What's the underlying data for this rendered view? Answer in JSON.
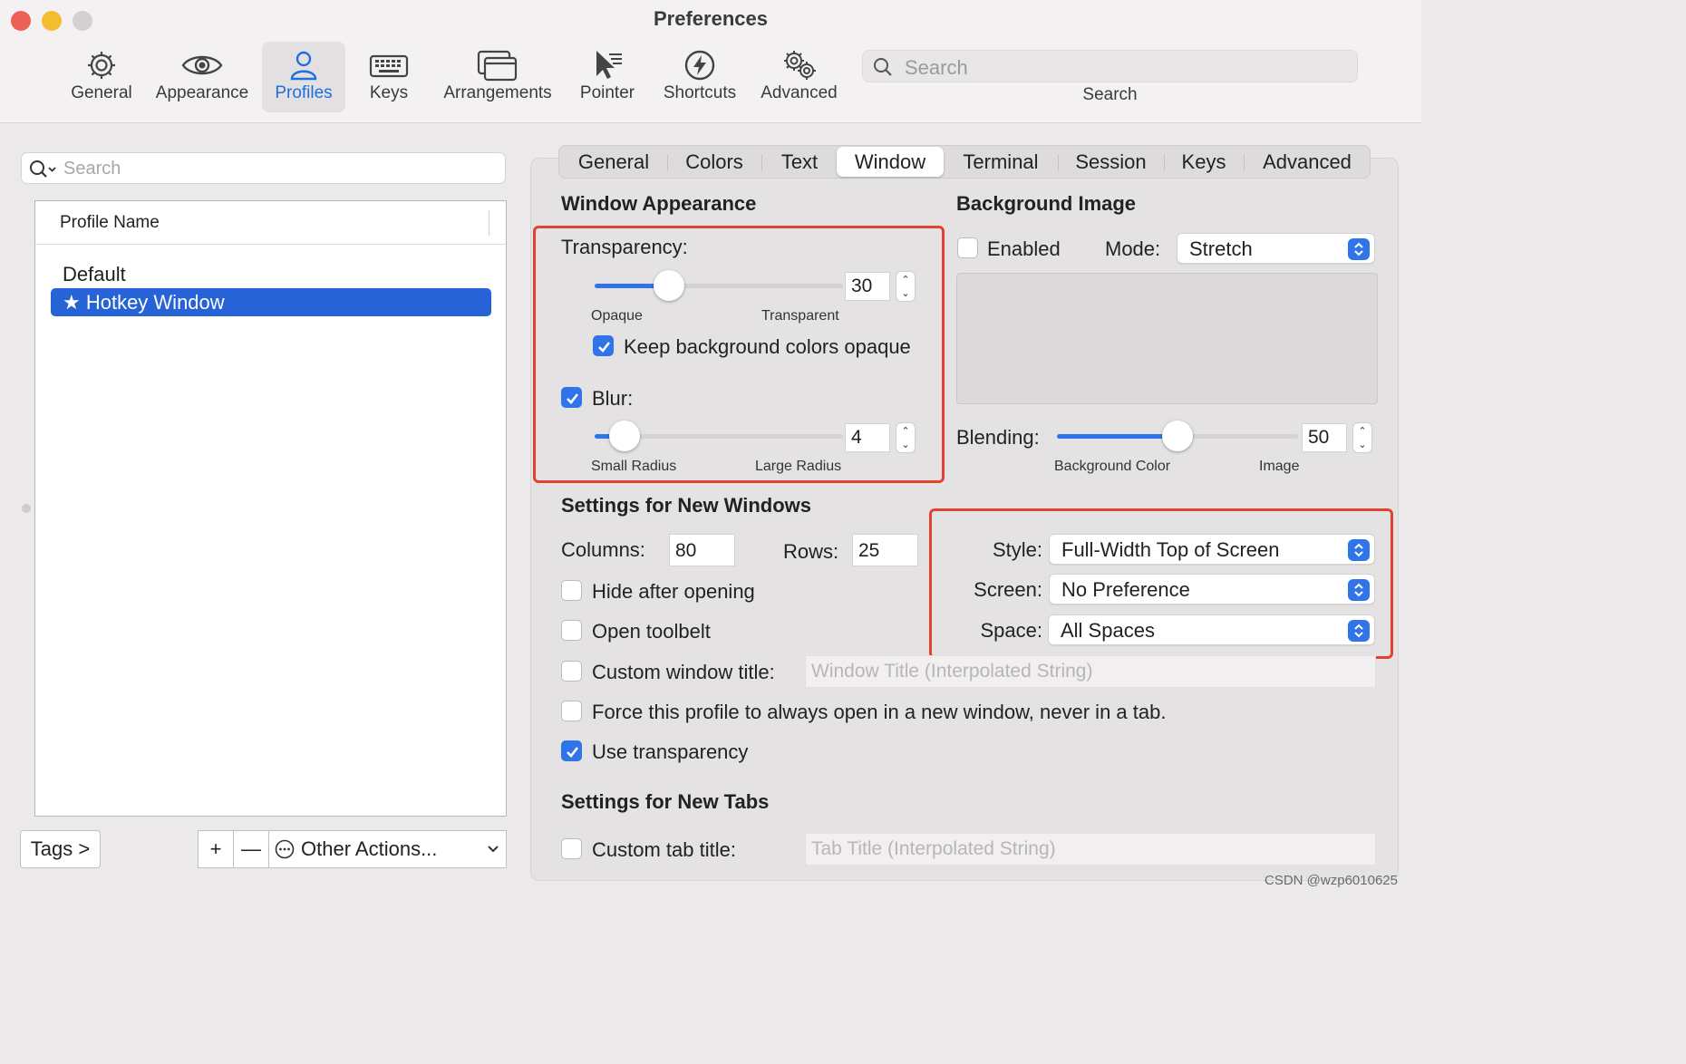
{
  "window": {
    "title": "Preferences",
    "traffic_lights": {
      "close": "#ee5f57",
      "minimize": "#f4bd2f",
      "zoom": "#d3d0d1"
    }
  },
  "toolbar": {
    "items": [
      {
        "label": "General",
        "icon": "gear-icon"
      },
      {
        "label": "Appearance",
        "icon": "eye-icon"
      },
      {
        "label": "Profiles",
        "icon": "person-icon",
        "active": true
      },
      {
        "label": "Keys",
        "icon": "keyboard-icon"
      },
      {
        "label": "Arrangements",
        "icon": "windows-icon"
      },
      {
        "label": "Pointer",
        "icon": "cursor-icon"
      },
      {
        "label": "Shortcuts",
        "icon": "lightning-icon"
      },
      {
        "label": "Advanced",
        "icon": "gears-icon"
      }
    ],
    "search_placeholder": "Search",
    "search_label": "Search",
    "accent": "#1f6fe0"
  },
  "profiles": {
    "search_placeholder": "Search",
    "column_header": "Profile Name",
    "items": [
      {
        "name": "Default"
      },
      {
        "name": "★ Hotkey Window",
        "selected": true
      }
    ],
    "tags_button": "Tags >",
    "add_button": "+",
    "remove_button": "—",
    "other_actions": "Other Actions..."
  },
  "tabs": [
    "General",
    "Colors",
    "Text",
    "Window",
    "Terminal",
    "Session",
    "Keys",
    "Advanced"
  ],
  "active_tab": "Window",
  "window_appearance": {
    "heading": "Window Appearance",
    "transparency_label": "Transparency:",
    "transparency_value": "30",
    "transparency_fraction": 0.3,
    "transparency_min": "Opaque",
    "transparency_max": "Transparent",
    "keep_bg_label": "Keep background colors opaque",
    "keep_bg_checked": true,
    "blur_label": "Blur:",
    "blur_checked": true,
    "blur_value": "4",
    "blur_fraction": 0.12,
    "blur_min": "Small Radius",
    "blur_max": "Large Radius"
  },
  "background_image": {
    "heading": "Background Image",
    "enabled_label": "Enabled",
    "enabled_checked": false,
    "mode_label": "Mode:",
    "mode_value": "Stretch",
    "blending_label": "Blending:",
    "blending_value": "50",
    "blending_fraction": 0.5,
    "blending_min": "Background Color",
    "blending_max": "Image"
  },
  "new_windows": {
    "heading": "Settings for New Windows",
    "columns_label": "Columns:",
    "columns_value": "80",
    "rows_label": "Rows:",
    "rows_value": "25",
    "style_label": "Style:",
    "style_value": "Full-Width Top of Screen",
    "screen_label": "Screen:",
    "screen_value": "No Preference",
    "space_label": "Space:",
    "space_value": "All Spaces",
    "hide_after_opening": {
      "label": "Hide after opening",
      "checked": false
    },
    "open_toolbelt": {
      "label": "Open toolbelt",
      "checked": false
    },
    "custom_title": {
      "label": "Custom window title:",
      "checked": false,
      "placeholder": "Window Title (Interpolated String)"
    },
    "force_new_window": {
      "label": "Force this profile to always open in a new window, never in a tab.",
      "checked": false
    },
    "use_transparency": {
      "label": "Use transparency",
      "checked": true
    }
  },
  "new_tabs": {
    "heading": "Settings for New Tabs",
    "custom_tab_title": {
      "label": "Custom tab title:",
      "checked": false,
      "placeholder": "Tab Title (Interpolated String)"
    }
  },
  "highlight_color": "#e2432f",
  "watermark": "CSDN @wzp6010625"
}
